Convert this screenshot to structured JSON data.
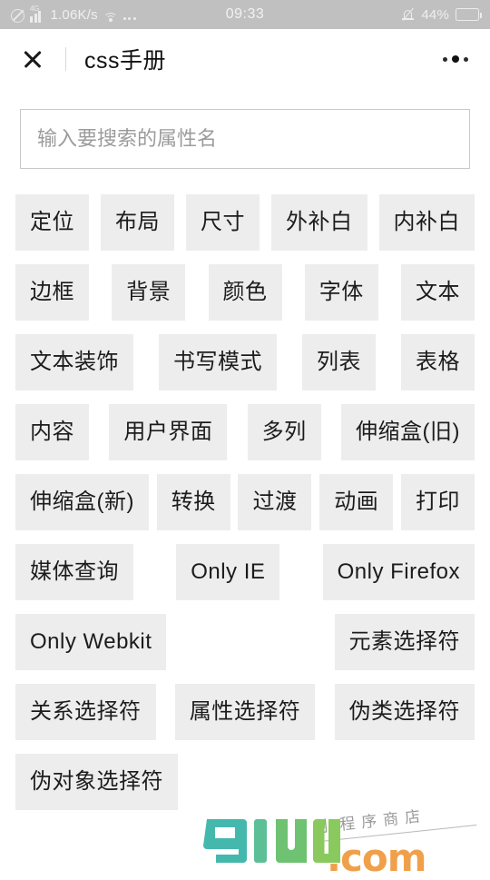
{
  "status_bar": {
    "dnd_icon": "do-not-disturb-icon",
    "signal_label": "4G",
    "network_speed": "1.06K/s",
    "wifi_icon": "wifi-icon",
    "more_icon": "more-dots-icon",
    "clock": "09:33",
    "bell_icon": "bell-muted-icon",
    "battery_percent": "44%",
    "battery_level": 44,
    "bg_color": "#c0c0c0",
    "fg_color": "#efefef"
  },
  "header": {
    "close_icon": "close-icon",
    "title": "css手册",
    "menu_icon": "more-options-icon"
  },
  "search": {
    "placeholder": "输入要搜索的属性名",
    "value": ""
  },
  "tag_rows": [
    [
      "定位",
      "布局",
      "尺寸",
      "外补白",
      "内补白"
    ],
    [
      "边框",
      "背景",
      "颜色",
      "字体",
      "文本"
    ],
    [
      "文本装饰",
      "书写模式",
      "列表",
      "表格"
    ],
    [
      "内容",
      "用户界面",
      "多列",
      "伸缩盒(旧)"
    ],
    [
      "伸缩盒(新)",
      "转换",
      "过渡",
      "动画",
      "打印"
    ],
    [
      "媒体查询",
      "Only IE",
      "Only Firefox"
    ],
    [
      "Only Webkit",
      "元素选择符"
    ],
    [
      "关系选择符",
      "属性选择符",
      "伪类选择符"
    ],
    [
      "伪对象选择符"
    ]
  ],
  "tag_style": {
    "background": "#ededed",
    "text_color": "#1c1c1c"
  },
  "watermark": {
    "brand_g": "g",
    "brand_rest": "1ud",
    "domain": ".com",
    "subtitle": "小程序商店",
    "color_teal": "#45b8ae",
    "color_green": "#7fc45f",
    "color_orange": "#f0a04b"
  }
}
